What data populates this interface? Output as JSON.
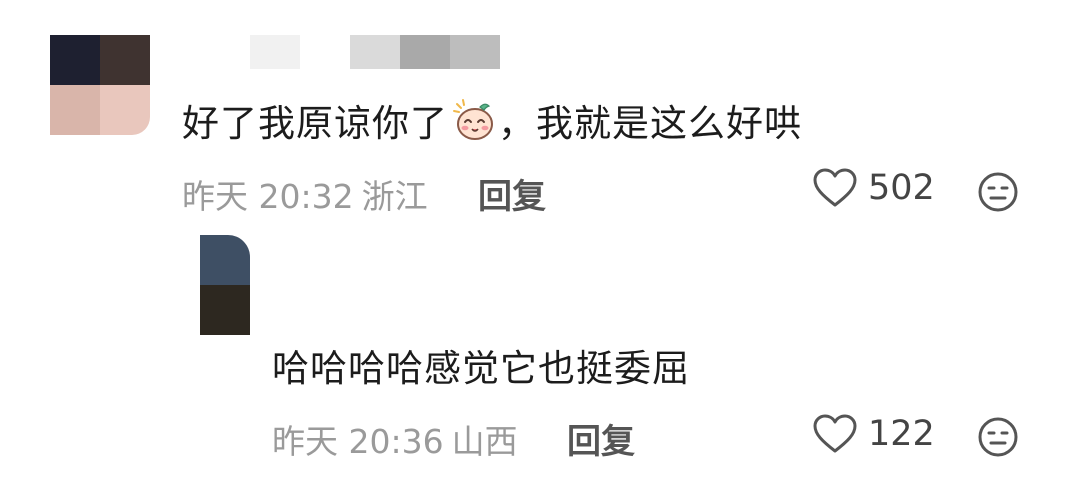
{
  "comments": [
    {
      "avatar_colors": [
        "#1e2030",
        "#3f3330",
        "#d9b5aa",
        "#e9c7bd"
      ],
      "username_mask_colors": [
        "#f1f1f1",
        "#dadada",
        "#a9a9a9",
        "#bdbdbd"
      ],
      "text_before_emoji": "好了我原谅你了",
      "emoji_icon": "blushing-face-sticker",
      "text_after_emoji": "，我就是这么好哄",
      "time": "昨天 20:32",
      "location": "浙江",
      "reply_label": "回复",
      "like_count": "502"
    }
  ],
  "replies": [
    {
      "avatar_colors": [
        "#3e4f64",
        "#2d2820"
      ],
      "text": "哈哈哈哈感觉它也挺委屈",
      "time": "昨天 20:36",
      "location": "山西",
      "reply_label": "回复",
      "like_count": "122"
    }
  ],
  "icons": {
    "like": "heart-outline-icon",
    "dislike": "neutral-face-icon"
  }
}
